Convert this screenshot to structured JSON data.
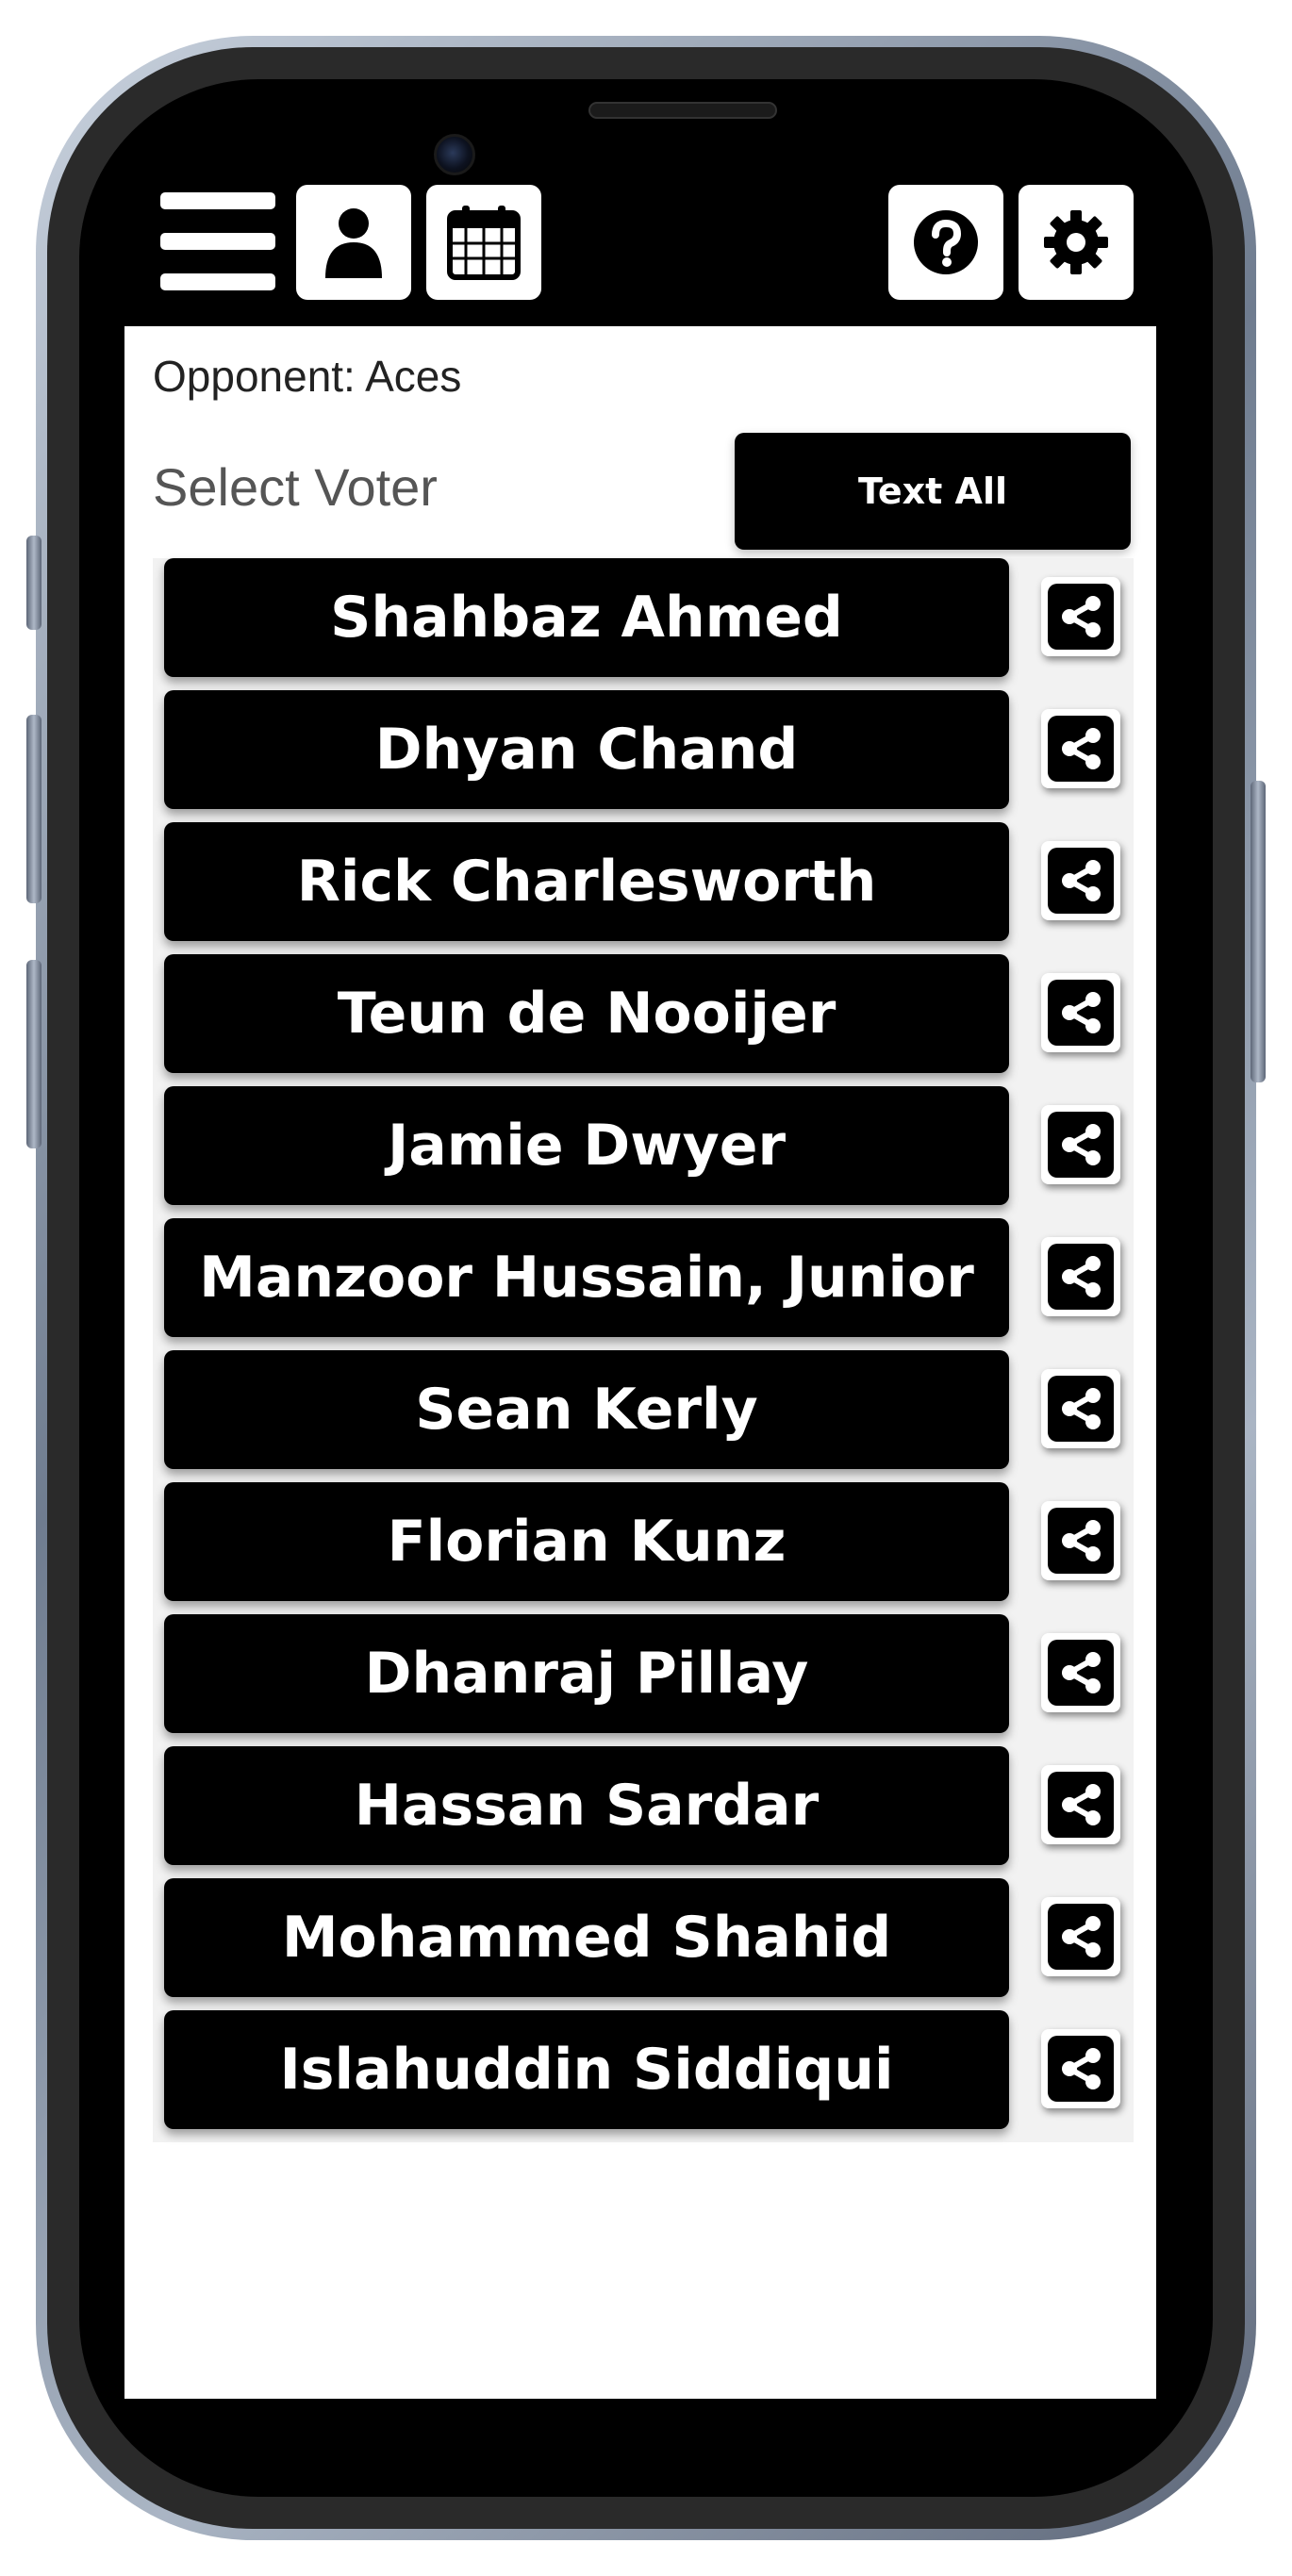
{
  "header": {
    "menu_icon": "hamburger-menu-icon",
    "profile_icon": "user-icon",
    "calendar_icon": "calendar-icon",
    "help_icon": "question-icon",
    "settings_icon": "gear-icon"
  },
  "match": {
    "opponent_label": "Opponent: Aces"
  },
  "voter": {
    "select_label": "Select Voter",
    "text_all_label": "Text All",
    "share_icon": "share-icon",
    "players": [
      "Shahbaz Ahmed",
      "Dhyan Chand",
      "Rick Charlesworth",
      "Teun de Nooijer",
      "Jamie Dwyer",
      "Manzoor Hussain, Junior",
      "Sean Kerly",
      "Florian Kunz",
      "Dhanraj Pillay",
      "Hassan Sardar",
      "Mohammed Shahid",
      "Islahuddin Siddiqui"
    ]
  },
  "colors": {
    "primary": "#000000",
    "background": "#ffffff",
    "list_background": "#f2f2f2"
  }
}
